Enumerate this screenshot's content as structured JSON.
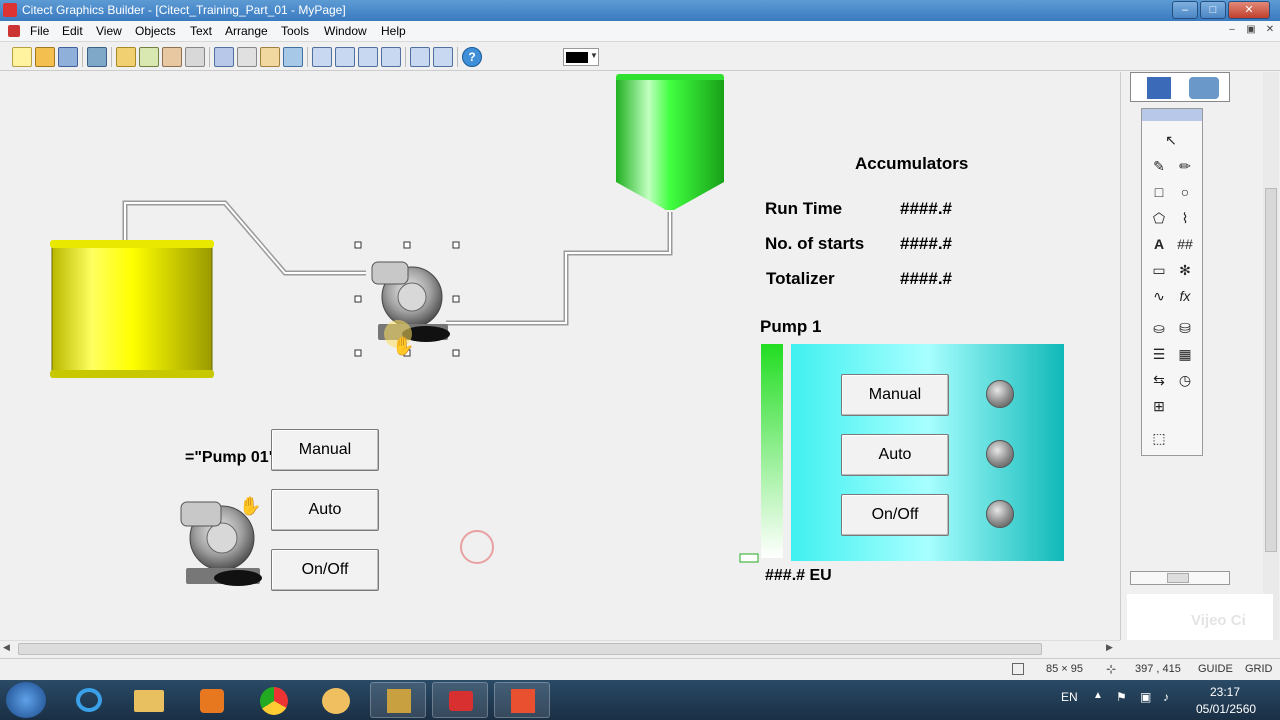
{
  "window": {
    "title": "Citect Graphics Builder - [Citect_Training_Part_01 - MyPage]",
    "min_label": "–",
    "max_label": "□",
    "close_label": "✕"
  },
  "menu": [
    "File",
    "Edit",
    "View",
    "Objects",
    "Text",
    "Arrange",
    "Tools",
    "Window",
    "Help"
  ],
  "mdi_controls": [
    "–",
    "▣",
    "✕"
  ],
  "toolbar": {
    "icons": [
      "new-page-icon",
      "open-icon",
      "save-icon",
      "print-icon",
      "cut-icon",
      "copy-icon",
      "paste-icon",
      "properties-icon",
      "library-icon",
      "duplicate-icon",
      "clipboard-icon",
      "undo-icon",
      "group-icon",
      "ungroup-icon",
      "bring-forward-icon",
      "send-backward-icon",
      "align-icon",
      "distribute-icon",
      "help-icon"
    ],
    "color_swatch": "#000000"
  },
  "canvas": {
    "tank_color": "#ffff00",
    "hopper_color": "#33ff33",
    "accumulators": {
      "title": "Accumulators",
      "rows": [
        {
          "label": "Run Time",
          "value": "####.#"
        },
        {
          "label": "No. of starts",
          "value": "####.#"
        },
        {
          "label": "Totalizer",
          "value": "####.#"
        }
      ]
    },
    "pump_panel": {
      "title": "Pump 1",
      "buttons": [
        "Manual",
        "Auto",
        "On/Off"
      ],
      "readout": "###.# EU",
      "panel_color": "#33e0e0"
    },
    "genie": {
      "label": "=\"Pump 01\"",
      "buttons": [
        "Manual",
        "Auto",
        "On/Off"
      ]
    }
  },
  "status": {
    "size": "85 × 95",
    "position": "397 , 415",
    "guide": "GUIDE",
    "grid": "GRID"
  },
  "right_panel": {
    "watermark": "Vijeo Ci"
  },
  "taskbar": {
    "lang": "EN",
    "time": "23:17",
    "date": "05/01/2560"
  }
}
